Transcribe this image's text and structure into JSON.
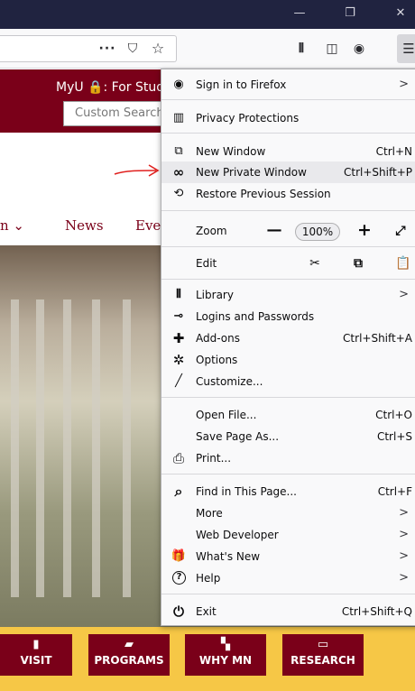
{
  "window": {
    "minimize_glyph": "—",
    "restore_glyph": "❐",
    "close_glyph": "✕"
  },
  "toolbar": {
    "page_actions_glyph": "···",
    "pocket_glyph": "⛉",
    "bookmark_glyph": "☆",
    "library_glyph": "⫴",
    "sidebar_glyph": "◫",
    "account_glyph": "◉",
    "menu_glyph": "☰"
  },
  "page": {
    "myu_text": "MyU 🔒: For Students",
    "search_placeholder": "Custom Search",
    "nav_partial": "n ⌄",
    "nav_news": "News",
    "nav_events": "Events",
    "actions": [
      {
        "icon": "▮",
        "label": "VISIT"
      },
      {
        "icon": "▰",
        "label": "PROGRAMS"
      },
      {
        "icon": "▚",
        "label": "WHY MN"
      },
      {
        "icon": "▭",
        "label": "RESEARCH"
      }
    ]
  },
  "menu": {
    "sign_in": {
      "label": "Sign in to Firefox",
      "chevron": ">"
    },
    "privacy": {
      "label": "Privacy Protections"
    },
    "new_window": {
      "label": "New Window",
      "shortcut": "Ctrl+N"
    },
    "new_private": {
      "label": "New Private Window",
      "shortcut": "Ctrl+Shift+P"
    },
    "restore": {
      "label": "Restore Previous Session"
    },
    "zoom": {
      "label": "Zoom",
      "minus": "—",
      "level": "100%",
      "plus": "+",
      "fullscreen": "⤢"
    },
    "edit": {
      "label": "Edit",
      "cut": "✂",
      "copy": "⧉",
      "paste": "📋"
    },
    "library": {
      "label": "Library",
      "chevron": ">"
    },
    "logins": {
      "label": "Logins and Passwords"
    },
    "addons": {
      "label": "Add-ons",
      "shortcut": "Ctrl+Shift+A"
    },
    "options": {
      "label": "Options"
    },
    "customize": {
      "label": "Customize..."
    },
    "open_file": {
      "label": "Open File...",
      "shortcut": "Ctrl+O"
    },
    "save_page": {
      "label": "Save Page As...",
      "shortcut": "Ctrl+S"
    },
    "print": {
      "label": "Print..."
    },
    "find": {
      "label": "Find in This Page...",
      "shortcut": "Ctrl+F"
    },
    "more": {
      "label": "More",
      "chevron": ">"
    },
    "web_dev": {
      "label": "Web Developer",
      "chevron": ">"
    },
    "whats_new": {
      "label": "What's New",
      "chevron": ">"
    },
    "help": {
      "label": "Help",
      "chevron": ">"
    },
    "exit": {
      "label": "Exit",
      "shortcut": "Ctrl+Shift+Q"
    }
  },
  "icons": {
    "sign_in": "◉",
    "privacy": "▥",
    "new_window": "⧉",
    "private": "∞",
    "restore": "⟲",
    "library": "⫴",
    "logins": "⊸",
    "addons": "✚",
    "options": "✲",
    "customize": "╱",
    "print": "⎙",
    "find": "⌕",
    "whats_new": "🎁",
    "help": "?",
    "exit": "⏻"
  },
  "colors": {
    "title_bar": "#202340",
    "brand_maroon": "#7a0019",
    "brand_gold": "#f6c746",
    "annotation_red": "#e0201e"
  }
}
